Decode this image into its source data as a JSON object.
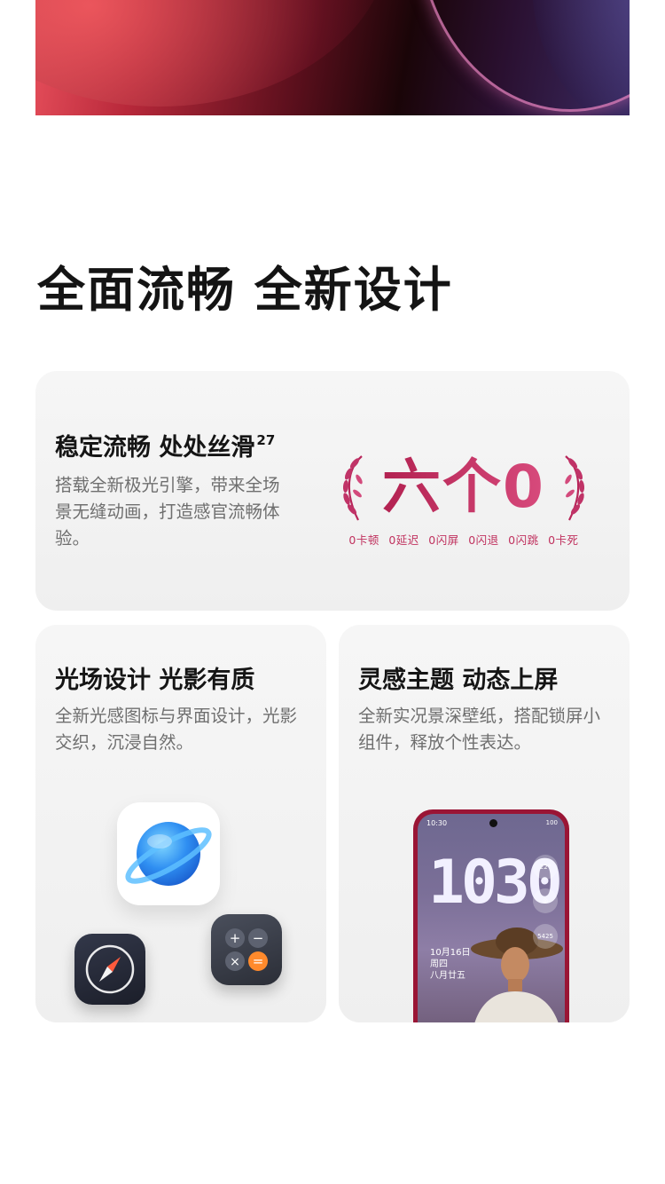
{
  "section_heading": "全面流畅 全新设计",
  "cards": {
    "smooth": {
      "title": "稳定流畅 处处丝滑",
      "footnote": "27",
      "desc": "搭载全新极光引擎，带来全场景无缝动画，打造感官流畅体验。",
      "badge_title": "六个0",
      "badge_items": [
        "0卡顿",
        "0延迟",
        "0闪屏",
        "0闪退",
        "0闪跳",
        "0卡死"
      ]
    },
    "light": {
      "title": "光场设计 光影有质",
      "desc": "全新光感图标与界面设计，光影交织，沉浸自然。"
    },
    "theme": {
      "title": "灵感主题 动态上屏",
      "desc": "全新实况景深壁纸，搭配锁屏小组件，释放个性表达。"
    }
  },
  "phone": {
    "status_time": "10:30",
    "status_battery": "100",
    "clock": "1030",
    "date": "10月16日",
    "weekday": "周四",
    "lunar": "八月廿五",
    "widget_weather": "22°",
    "widget_steps": "5425"
  },
  "icons": [
    "planet-browser-icon",
    "compass-icon",
    "calculator-icon"
  ],
  "colors": {
    "badge_accent": "#c7265c",
    "phone_frame": "#9a1535",
    "card_bg": "#f3f3f3"
  }
}
